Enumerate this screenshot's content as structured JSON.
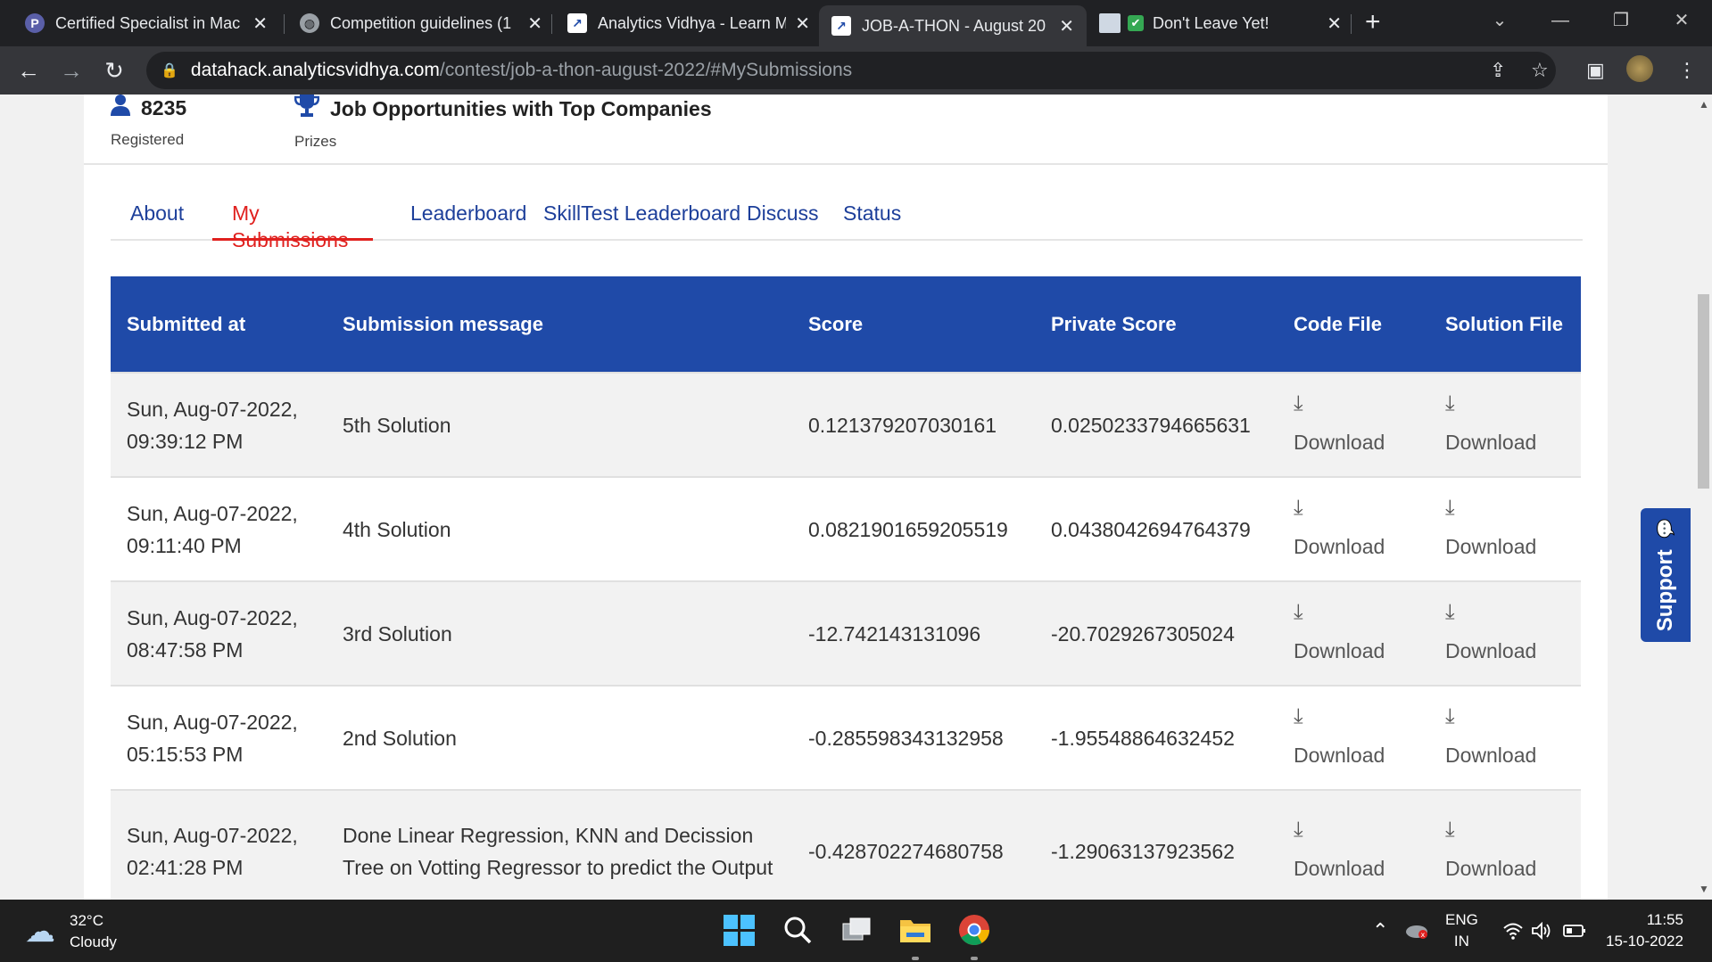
{
  "browser": {
    "tabs": [
      {
        "title": "Certified Specialist in Mac",
        "favicon_letter": "P",
        "favicon_color": "#ffffff",
        "favicon_bg": "#5a5fa8",
        "active": false
      },
      {
        "title": "Competition guidelines (1",
        "favicon_letter": "◍",
        "favicon_color": "#e8eaed",
        "favicon_bg": "#202124",
        "active": false
      },
      {
        "title": "Analytics Vidhya - Learn M",
        "favicon_letter": "↗",
        "favicon_color": "#ffffff",
        "favicon_bg": "#202124",
        "active": false
      },
      {
        "title": "JOB-A-THON - August 20",
        "favicon_letter": "↗",
        "favicon_color": "#ffffff",
        "favicon_bg": "#35363a",
        "active": true
      },
      {
        "title": "Don't Leave Yet!",
        "favicon_letter": "✔",
        "favicon_color": "#ffffff",
        "favicon_bg": "#35a853",
        "active": false
      }
    ],
    "url_host": "datahack.analyticsvidhya.com",
    "url_path": "/contest/job-a-thon-august-2022/#MySubmissions",
    "icons": {
      "back": "←",
      "forward": "→",
      "reload": "↻",
      "lock": "🔒",
      "share": "⇪",
      "star": "☆",
      "sidepanel": "▣",
      "menu": "⋮",
      "newtab": "+",
      "close": "✕",
      "minimize": "—",
      "restore": "❐",
      "dropdown": "⌄"
    }
  },
  "stats": [
    {
      "value": "8235",
      "label": "Registered",
      "icon": "user-icon",
      "glyph": "👤"
    },
    {
      "value": "Job Opportunities with Top Companies",
      "label": "Prizes",
      "icon": "trophy-icon",
      "glyph": "🏆"
    }
  ],
  "page_tabs": [
    {
      "label": "About",
      "active": false
    },
    {
      "label": "My Submissions",
      "active": true
    },
    {
      "label": "Leaderboard",
      "active": false
    },
    {
      "label": "SkillTest Leaderboard",
      "active": false
    },
    {
      "label": "Discuss",
      "active": false
    },
    {
      "label": "Status",
      "active": false
    }
  ],
  "table": {
    "headers": [
      "Submitted at",
      "Submission message",
      "Score",
      "Private Score",
      "Code File",
      "Solution File"
    ],
    "rows": [
      {
        "submitted": "Sun, Aug-07-2022, 09:39:12 PM",
        "message": "5th Solution",
        "score": "0.121379207030161",
        "private_score": "0.0250233794665631",
        "code": "Download",
        "solution": "Download"
      },
      {
        "submitted": "Sun, Aug-07-2022, 09:11:40 PM",
        "message": "4th Solution",
        "score": "0.0821901659205519",
        "private_score": "0.0438042694764379",
        "code": "Download",
        "solution": "Download"
      },
      {
        "submitted": "Sun, Aug-07-2022, 08:47:58 PM",
        "message": "3rd Solution",
        "score": "-12.742143131096",
        "private_score": "-20.7029267305024",
        "code": "Download",
        "solution": "Download"
      },
      {
        "submitted": "Sun, Aug-07-2022, 05:15:53 PM",
        "message": "2nd Solution",
        "score": "-0.285598343132958",
        "private_score": "-1.95548864632452",
        "code": "Download",
        "solution": "Download"
      },
      {
        "submitted": "Sun, Aug-07-2022, 02:41:28 PM",
        "message": "Done Linear Regression, KNN and Decission Tree on Votting Regressor to predict the Output",
        "score": "-0.428702274680758",
        "private_score": "-1.29063137923562",
        "code": "Download",
        "solution": "Download"
      }
    ],
    "download_icon": "⤓"
  },
  "support": {
    "label": "Support",
    "icon": "chat-bubble-icon",
    "glyph": "💬"
  },
  "taskbar": {
    "temperature": "32°C",
    "condition": "Cloudy",
    "language_top": "ENG",
    "language_bottom": "IN",
    "time": "11:55",
    "date": "15-10-2022",
    "glyphs": {
      "cloud": "☁",
      "search": "⌕",
      "folder": "📁",
      "chevron_up": "⌃",
      "wifi": "◠",
      "volume": "🔈",
      "battery": "▭"
    }
  },
  "colors": {
    "brand_blue": "#1f4aa8",
    "active_tab_red": "#e0201e",
    "link_blue": "#1d3f9a"
  }
}
